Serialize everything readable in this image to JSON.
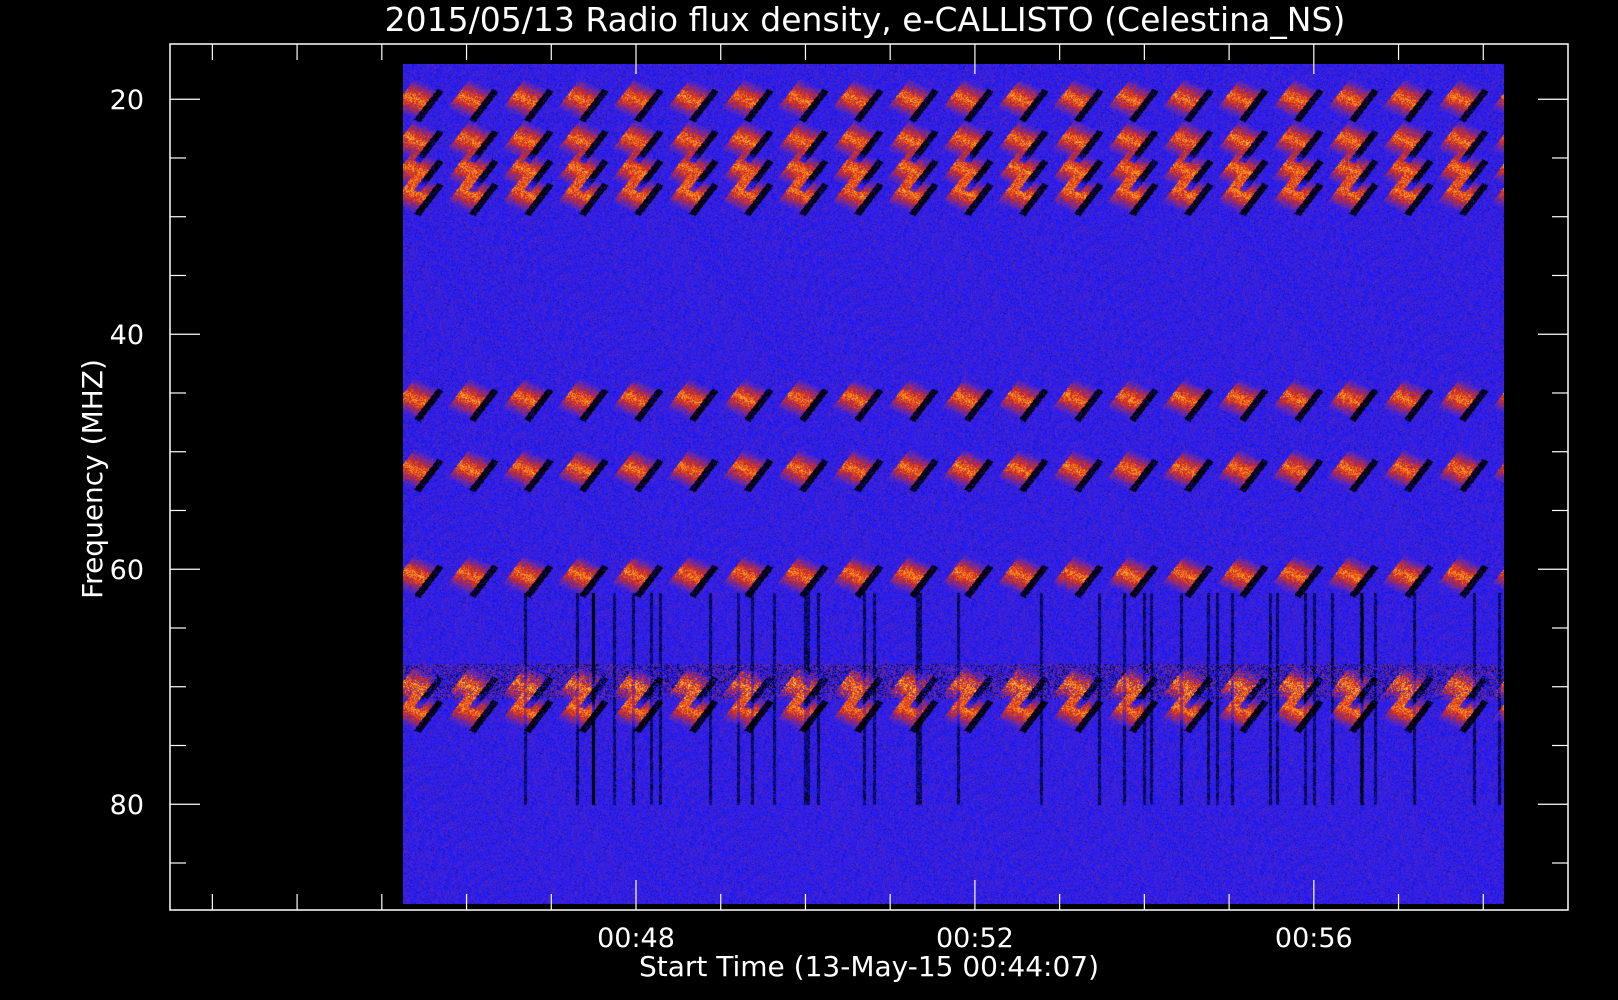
{
  "chart_data": {
    "type": "heatmap",
    "title": "2015/05/13  Radio flux density, e-CALLISTO (Celestina_NS)",
    "xlabel": "Start Time (13-May-15 00:44:07)",
    "ylabel": "Frequency (MHZ)",
    "x_ticks": [
      "00:48",
      "00:52",
      "00:56"
    ],
    "y_ticks": [
      "20",
      "40",
      "60",
      "80"
    ],
    "x_range": [
      "00:42:30",
      "00:59:00"
    ],
    "y_range": [
      15.3,
      89.0
    ],
    "y_reversed": true,
    "data_extent": {
      "time_start": "00:45:15",
      "time_end": "00:58:15",
      "freq_low": 17.0,
      "freq_high": 88.5
    },
    "colormap": [
      "#000000",
      "#1a1aff",
      "#6a2aa8",
      "#d42a1a",
      "#ff8a1a",
      "#ffd84a"
    ],
    "features": [
      {
        "freq": 19.5,
        "kind": "persistent-band"
      },
      {
        "freq": 23.0,
        "kind": "persistent-band"
      },
      {
        "freq": 25.5,
        "kind": "persistent-band"
      },
      {
        "freq": 27.5,
        "kind": "persistent-band"
      },
      {
        "freq": 45.0,
        "kind": "band"
      },
      {
        "freq": 51.0,
        "kind": "band"
      },
      {
        "freq": 60.0,
        "kind": "band"
      },
      {
        "freq": 69.5,
        "kind": "burst-band"
      },
      {
        "freq": 71.5,
        "kind": "burst-band"
      }
    ]
  }
}
